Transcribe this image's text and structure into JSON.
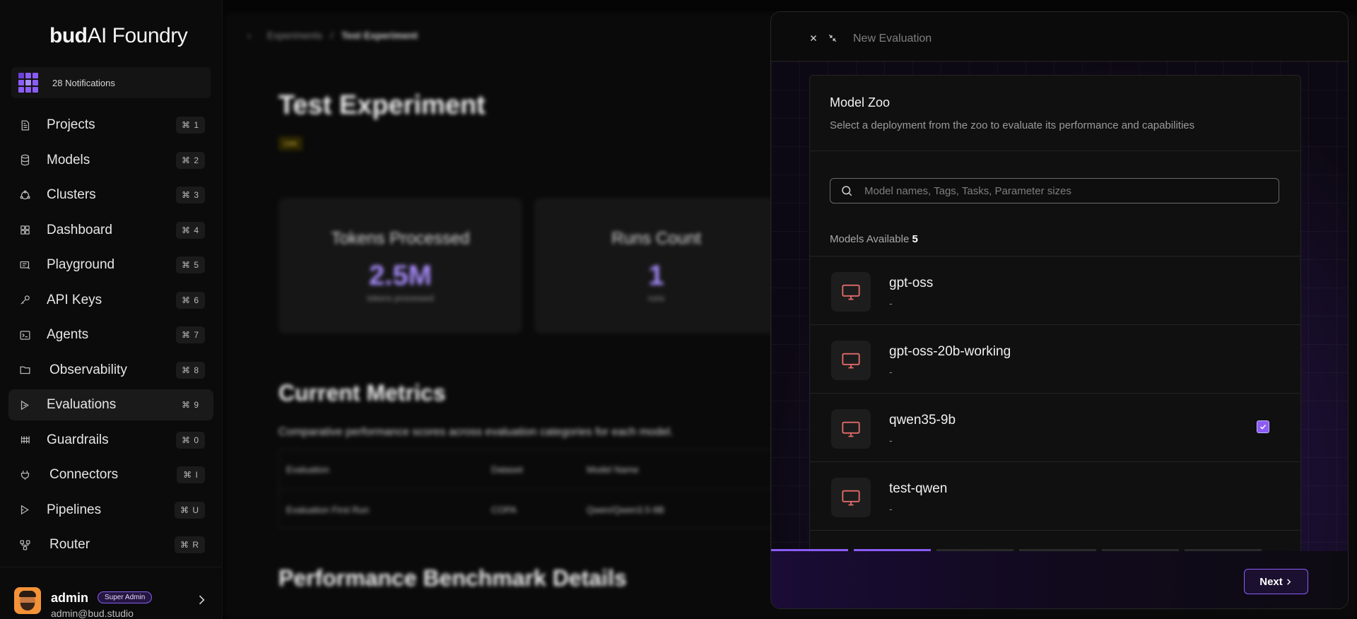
{
  "brand": {
    "prefix": "bud",
    "name": "AI Foundry"
  },
  "notifications": {
    "label": "28 Notifications"
  },
  "sidebar": {
    "items": [
      {
        "label": "Projects",
        "shortcut": "⌘ 1",
        "icon": "file-icon"
      },
      {
        "label": "Models",
        "shortcut": "⌘ 2",
        "icon": "database-icon"
      },
      {
        "label": "Clusters",
        "shortcut": "⌘ 3",
        "icon": "cluster-icon"
      },
      {
        "label": "Dashboard",
        "shortcut": "⌘ 4",
        "icon": "grid-icon"
      },
      {
        "label": "Playground",
        "shortcut": "⌘ 5",
        "icon": "playground-icon"
      },
      {
        "label": "API Keys",
        "shortcut": "⌘ 6",
        "icon": "key-icon"
      },
      {
        "label": "Agents",
        "shortcut": "⌘ 7",
        "icon": "terminal-icon"
      },
      {
        "label": "Observability",
        "shortcut": "⌘ 8",
        "icon": "folder-icon"
      },
      {
        "label": "Evaluations",
        "shortcut": "⌘ 9",
        "icon": "evaluation-icon",
        "active": true
      },
      {
        "label": "Guardrails",
        "shortcut": "⌘ 0",
        "icon": "guardrail-icon"
      },
      {
        "label": "Connectors",
        "shortcut": "⌘ I",
        "icon": "plug-icon"
      },
      {
        "label": "Pipelines",
        "shortcut": "⌘ U",
        "icon": "pipeline-icon"
      },
      {
        "label": "Router",
        "shortcut": "⌘ R",
        "icon": "router-icon"
      }
    ]
  },
  "user": {
    "name": "admin",
    "role": "Super Admin",
    "email": "admin@bud.studio"
  },
  "background": {
    "breadcrumb": {
      "parent": "Experiments",
      "separator": "/",
      "current": "Test Experiment"
    },
    "title": "Test Experiment",
    "tag": "Live",
    "cards": [
      {
        "title": "Tokens Processed",
        "value": "2.5M",
        "sub": "tokens processed"
      },
      {
        "title": "Runs Count",
        "value": "1",
        "sub": "runs"
      }
    ],
    "metrics_title": "Current Metrics",
    "metrics_sub": "Comparative performance scores across evaluation categories for each model.",
    "table": {
      "headers": [
        "Evaluation",
        "Dataset",
        "Model Name"
      ],
      "rows": [
        [
          "Evaluation First Run",
          "COPA",
          "Qwen/Qwen3.5-9B"
        ]
      ]
    },
    "benchmark_title": "Performance Benchmark Details"
  },
  "drawer": {
    "title": "New Evaluation",
    "panel_title": "Model Zoo",
    "panel_subtitle": "Select a deployment from the zoo to evaluate its performance and capabilities",
    "search_placeholder": "Model names, Tags, Tasks, Parameter sizes",
    "available_label": "Models Available",
    "available_count": "5",
    "models": [
      {
        "name": "gpt-oss",
        "desc": "-",
        "selected": false
      },
      {
        "name": "gpt-oss-20b-working",
        "desc": "-",
        "selected": false
      },
      {
        "name": "qwen35-9b",
        "desc": "-",
        "selected": true
      },
      {
        "name": "test-qwen",
        "desc": "-",
        "selected": false
      }
    ],
    "progress": {
      "total_steps": 6,
      "completed_steps": 2
    },
    "next_label": "Next"
  },
  "colors": {
    "accent": "#8b5cf6",
    "model_icon": "#e46a6a",
    "background": "#050505"
  }
}
